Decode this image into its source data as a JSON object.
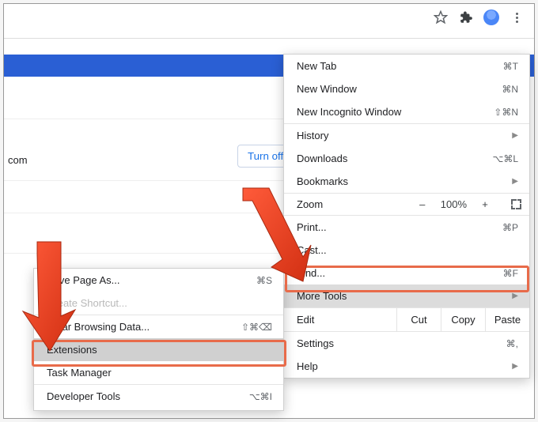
{
  "toolbar": {
    "star_icon": "star-icon",
    "puzzle_icon": "extensions-icon",
    "avatar_icon": "profile-avatar",
    "menu_icon": "more-icon"
  },
  "page": {
    "partial_text": "com",
    "turnoff_label": "Turn off"
  },
  "main_menu": {
    "new_tab": {
      "label": "New Tab",
      "shortcut": "⌘T"
    },
    "new_window": {
      "label": "New Window",
      "shortcut": "⌘N"
    },
    "new_incognito": {
      "label": "New Incognito Window",
      "shortcut": "⇧⌘N"
    },
    "history": {
      "label": "History"
    },
    "downloads": {
      "label": "Downloads",
      "shortcut": "⌥⌘L"
    },
    "bookmarks": {
      "label": "Bookmarks"
    },
    "zoom": {
      "label": "Zoom",
      "value": "100%",
      "minus": "–",
      "plus": "+"
    },
    "print": {
      "label": "Print...",
      "shortcut": "⌘P"
    },
    "cast": {
      "label": "Cast..."
    },
    "find": {
      "label": "Find...",
      "shortcut": "⌘F"
    },
    "more_tools": {
      "label": "More Tools"
    },
    "edit": {
      "label": "Edit",
      "cut": "Cut",
      "copy": "Copy",
      "paste": "Paste"
    },
    "settings": {
      "label": "Settings",
      "shortcut": "⌘,"
    },
    "help": {
      "label": "Help"
    }
  },
  "sub_menu": {
    "save_page": {
      "label": "Save Page As...",
      "shortcut": "⌘S"
    },
    "create_shortcut": {
      "label": "Create Shortcut..."
    },
    "clear_data": {
      "label": "Clear Browsing Data...",
      "shortcut": "⇧⌘⌫"
    },
    "extensions": {
      "label": "Extensions"
    },
    "task_manager": {
      "label": "Task Manager"
    },
    "dev_tools": {
      "label": "Developer Tools",
      "shortcut": "⌥⌘I"
    }
  }
}
